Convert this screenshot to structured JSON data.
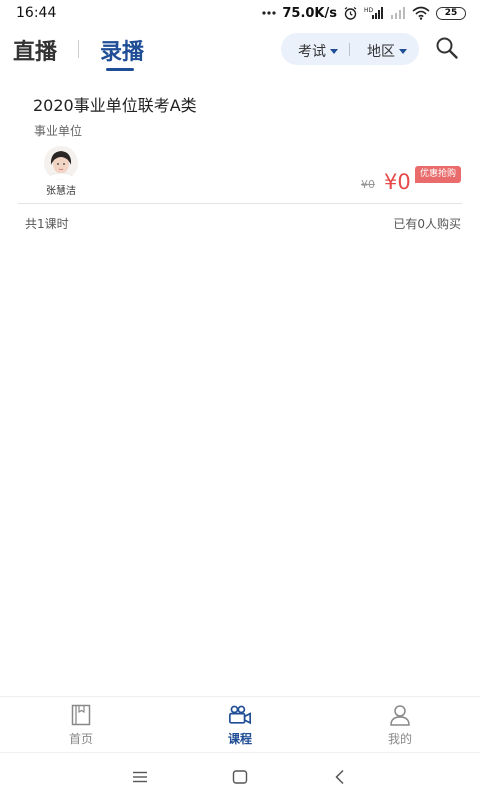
{
  "status_bar": {
    "time": "16:44",
    "network_speed": "75.0K/s",
    "battery_level": "25",
    "icons": [
      "dots-icon",
      "alarm-icon",
      "hd-signal-icon",
      "signal-icon",
      "wifi-icon",
      "battery-icon"
    ]
  },
  "header": {
    "tab_live": "直播",
    "tab_recorded": "录播",
    "active_tab": "录播",
    "filter_exam": "考试",
    "filter_area": "地区",
    "accent_color": "#1f4e96"
  },
  "course": {
    "title": "2020事业单位联考A类",
    "category": "事业单位",
    "teacher_name": "张慧洁",
    "original_price": "¥0",
    "current_price": "¥0",
    "promo_badge": "优惠抢购",
    "lesson_count": "共1课时",
    "buyers": "已有0人购买",
    "price_color": "#e64a4a"
  },
  "bottom_nav": {
    "items": [
      {
        "label": "首页",
        "icon": "book-icon"
      },
      {
        "label": "课程",
        "icon": "video-camera-icon"
      },
      {
        "label": "我的",
        "icon": "user-icon"
      }
    ],
    "active": "课程"
  },
  "system_nav": {
    "icons": [
      "menu-icon",
      "home-icon",
      "back-icon"
    ]
  }
}
